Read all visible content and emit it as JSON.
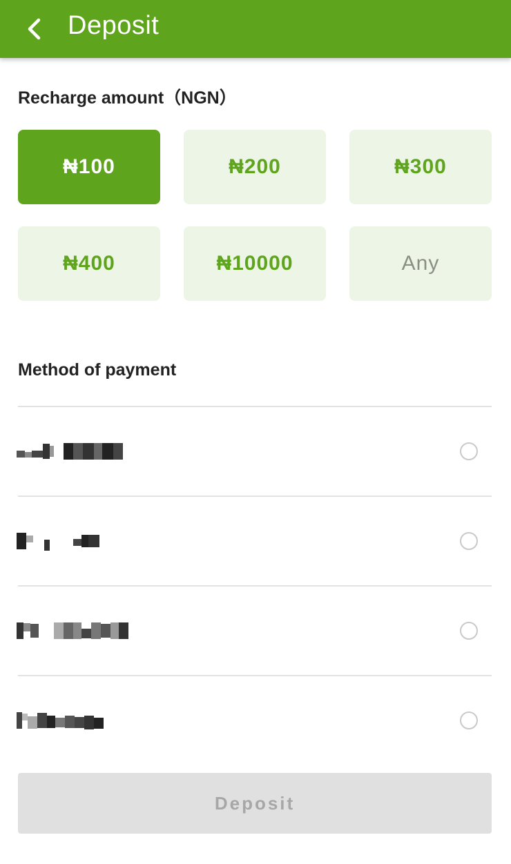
{
  "header": {
    "title": "Deposit",
    "back_icon": "chevron-left-icon",
    "bg_color": "#5fa41d"
  },
  "amount_section": {
    "title": "Recharge amount（NGN）",
    "options": [
      {
        "label": "₦100",
        "selected": true
      },
      {
        "label": "₦200",
        "selected": false
      },
      {
        "label": "₦300",
        "selected": false
      },
      {
        "label": "₦400",
        "selected": false
      },
      {
        "label": "₦10000",
        "selected": false
      },
      {
        "label": "Any",
        "selected": false
      }
    ],
    "selected_color": "#5fa41d",
    "unselected_bg": "#edf5e6"
  },
  "payment_section": {
    "title": "Method of payment",
    "methods": [
      {
        "label": "",
        "blurred": true,
        "selected": false
      },
      {
        "label": "",
        "blurred": true,
        "selected": false
      },
      {
        "label": "",
        "blurred": true,
        "selected": false
      },
      {
        "label": "",
        "blurred": true,
        "selected": false
      }
    ]
  },
  "submit": {
    "label": "Deposit",
    "enabled": false
  }
}
